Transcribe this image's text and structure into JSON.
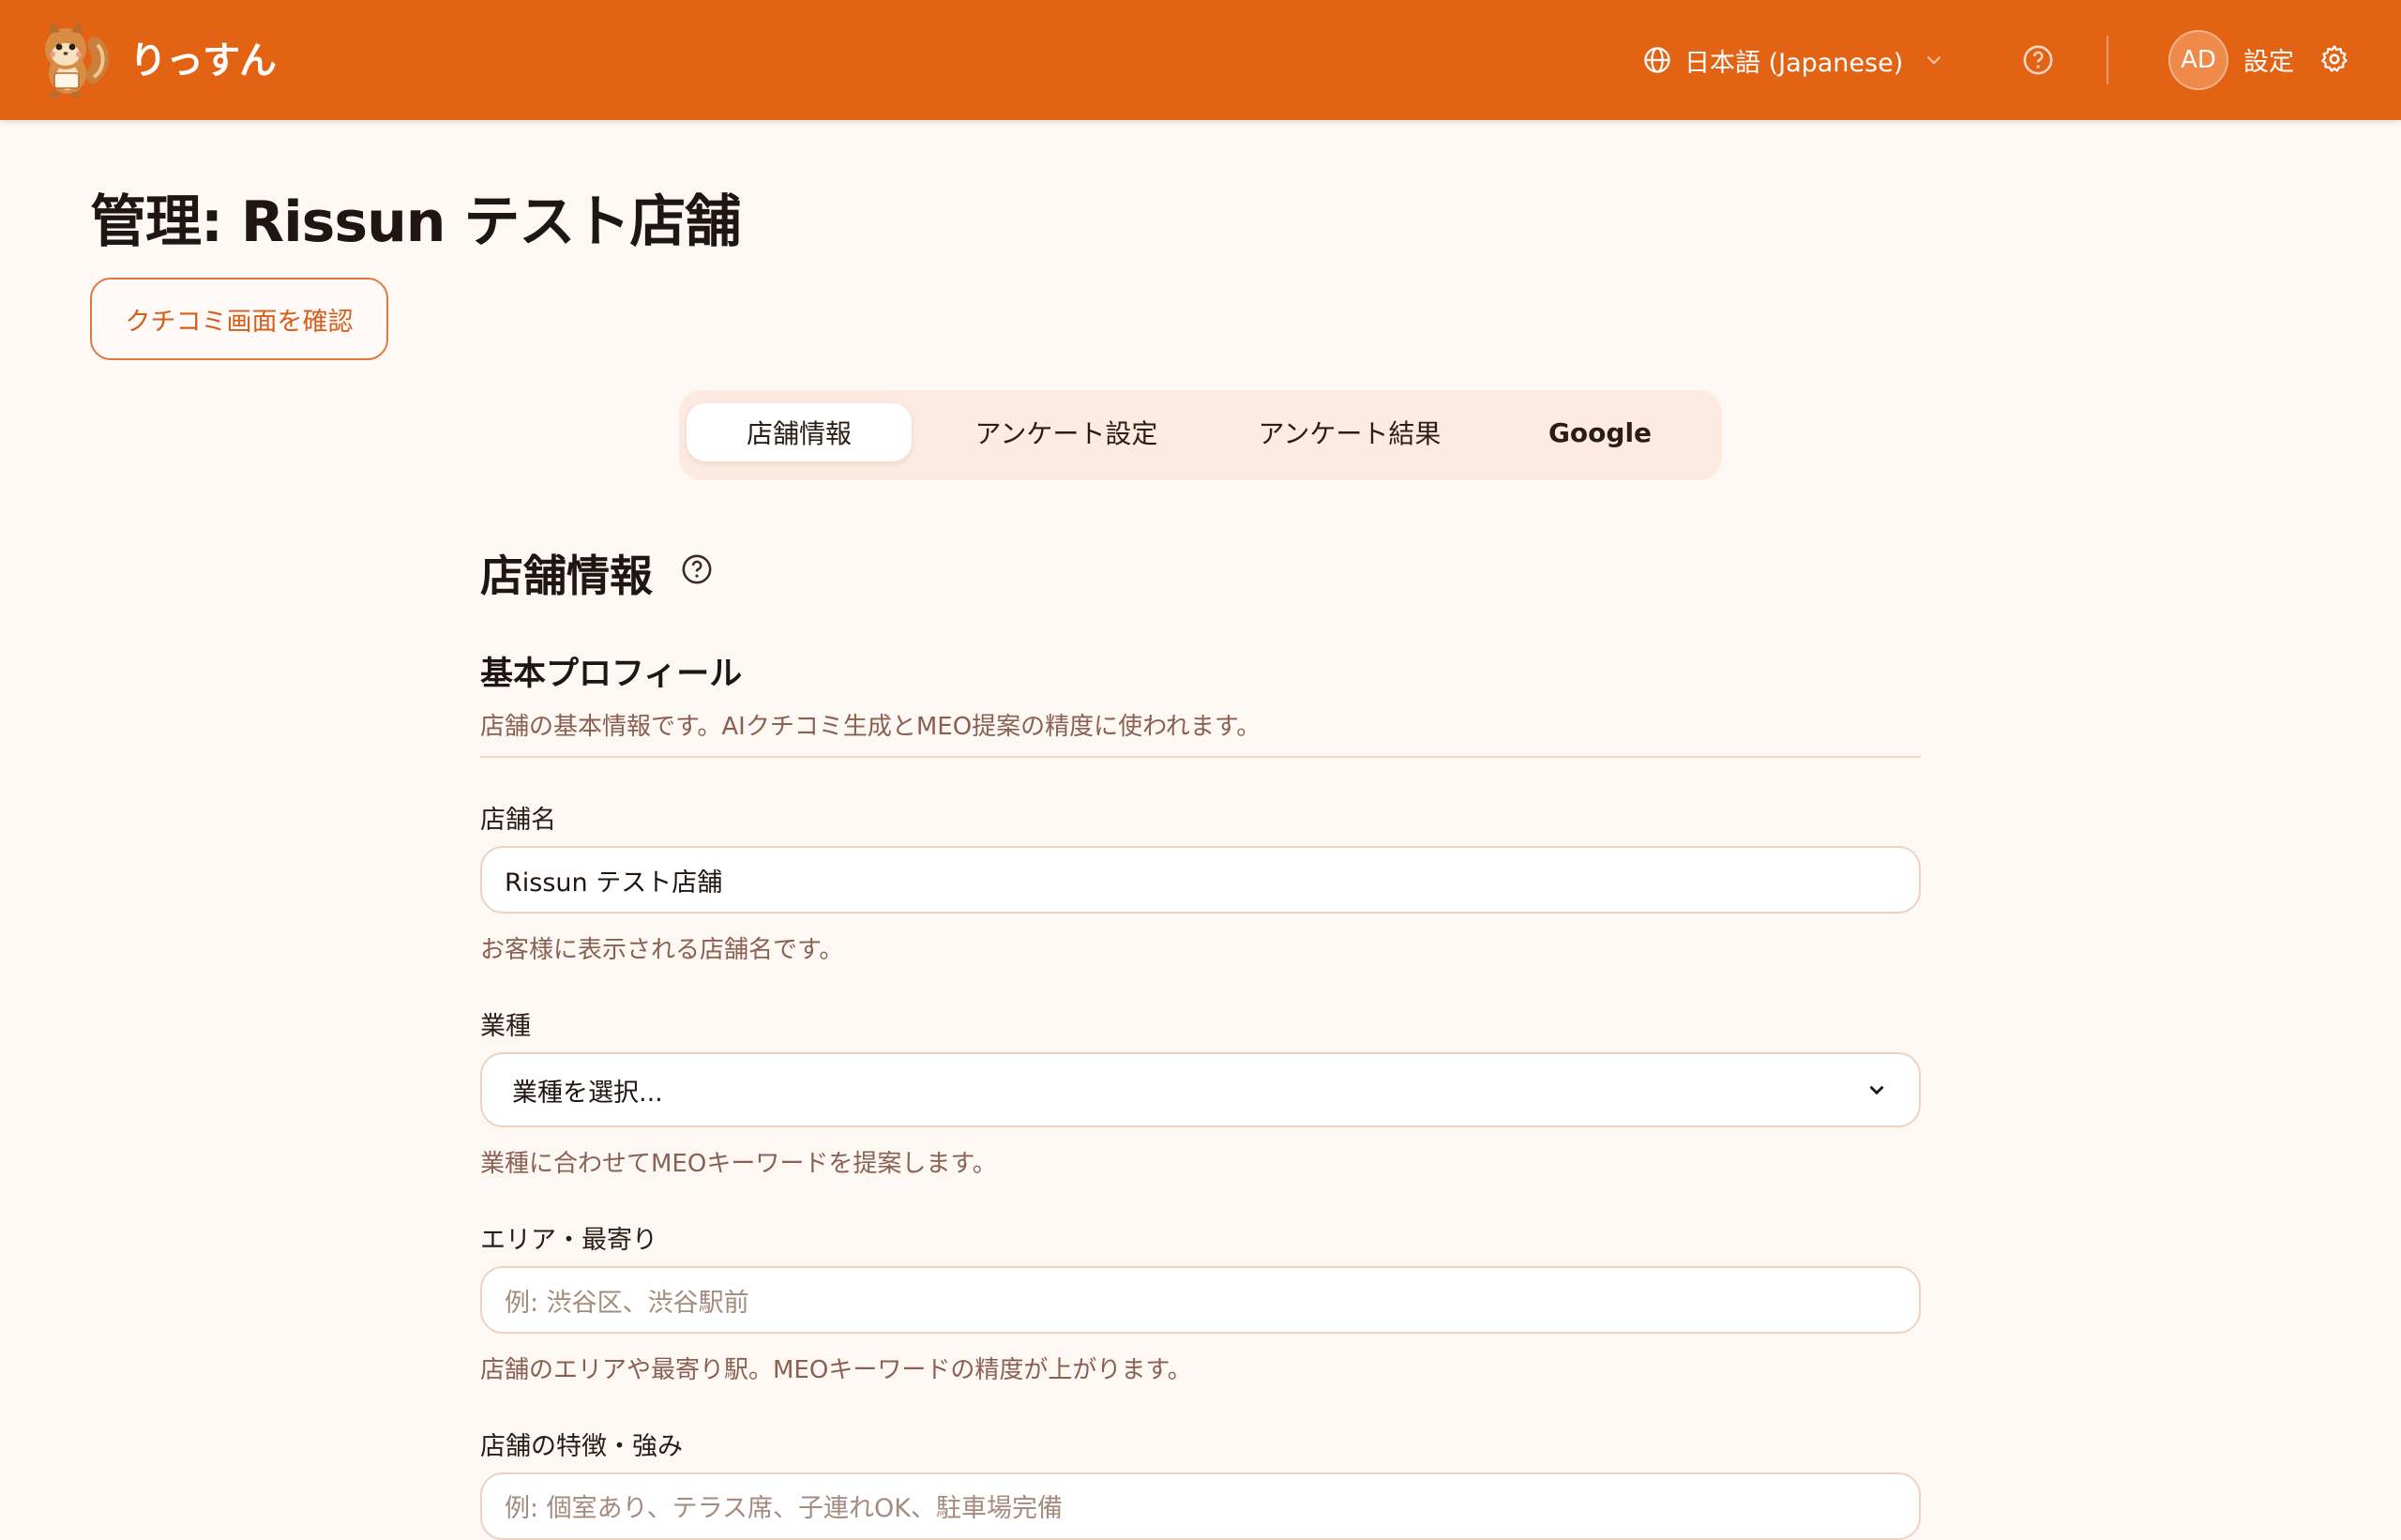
{
  "header": {
    "logo_text": "りっすん",
    "language_label": "日本語 (Japanese)",
    "avatar_initials": "AD",
    "settings_label": "設定"
  },
  "page": {
    "title": "管理: Rissun テスト店舗",
    "review_button": "クチコミ画面を確認"
  },
  "tabs": [
    {
      "label": "店舗情報",
      "active": true
    },
    {
      "label": "アンケート設定",
      "active": false
    },
    {
      "label": "アンケート結果",
      "active": false
    },
    {
      "label": "Google",
      "active": false
    }
  ],
  "section": {
    "title": "店舗情報",
    "subsection_title": "基本プロフィール",
    "subsection_desc": "店舗の基本情報です。AIクチコミ生成とMEO提案の精度に使われます。"
  },
  "fields": {
    "store_name": {
      "label": "店舗名",
      "value": "Rissun テスト店舗",
      "help": "お客様に表示される店舗名です。"
    },
    "industry": {
      "label": "業種",
      "selected": "業種を選択...",
      "help": "業種に合わせてMEOキーワードを提案します。"
    },
    "area": {
      "label": "エリア・最寄り",
      "placeholder": "例: 渋谷区、渋谷駅前",
      "help": "店舗のエリアや最寄り駅。MEOキーワードの精度が上がります。"
    },
    "features": {
      "label": "店舗の特徴・強み",
      "placeholder": "例: 個室あり、テラス席、子連れOK、駐車場完備"
    }
  },
  "colors": {
    "header_bg": "#e36315",
    "page_bg": "#fef8f5",
    "accent": "#df7a3d",
    "tab_bar_bg": "#fdeae0"
  }
}
